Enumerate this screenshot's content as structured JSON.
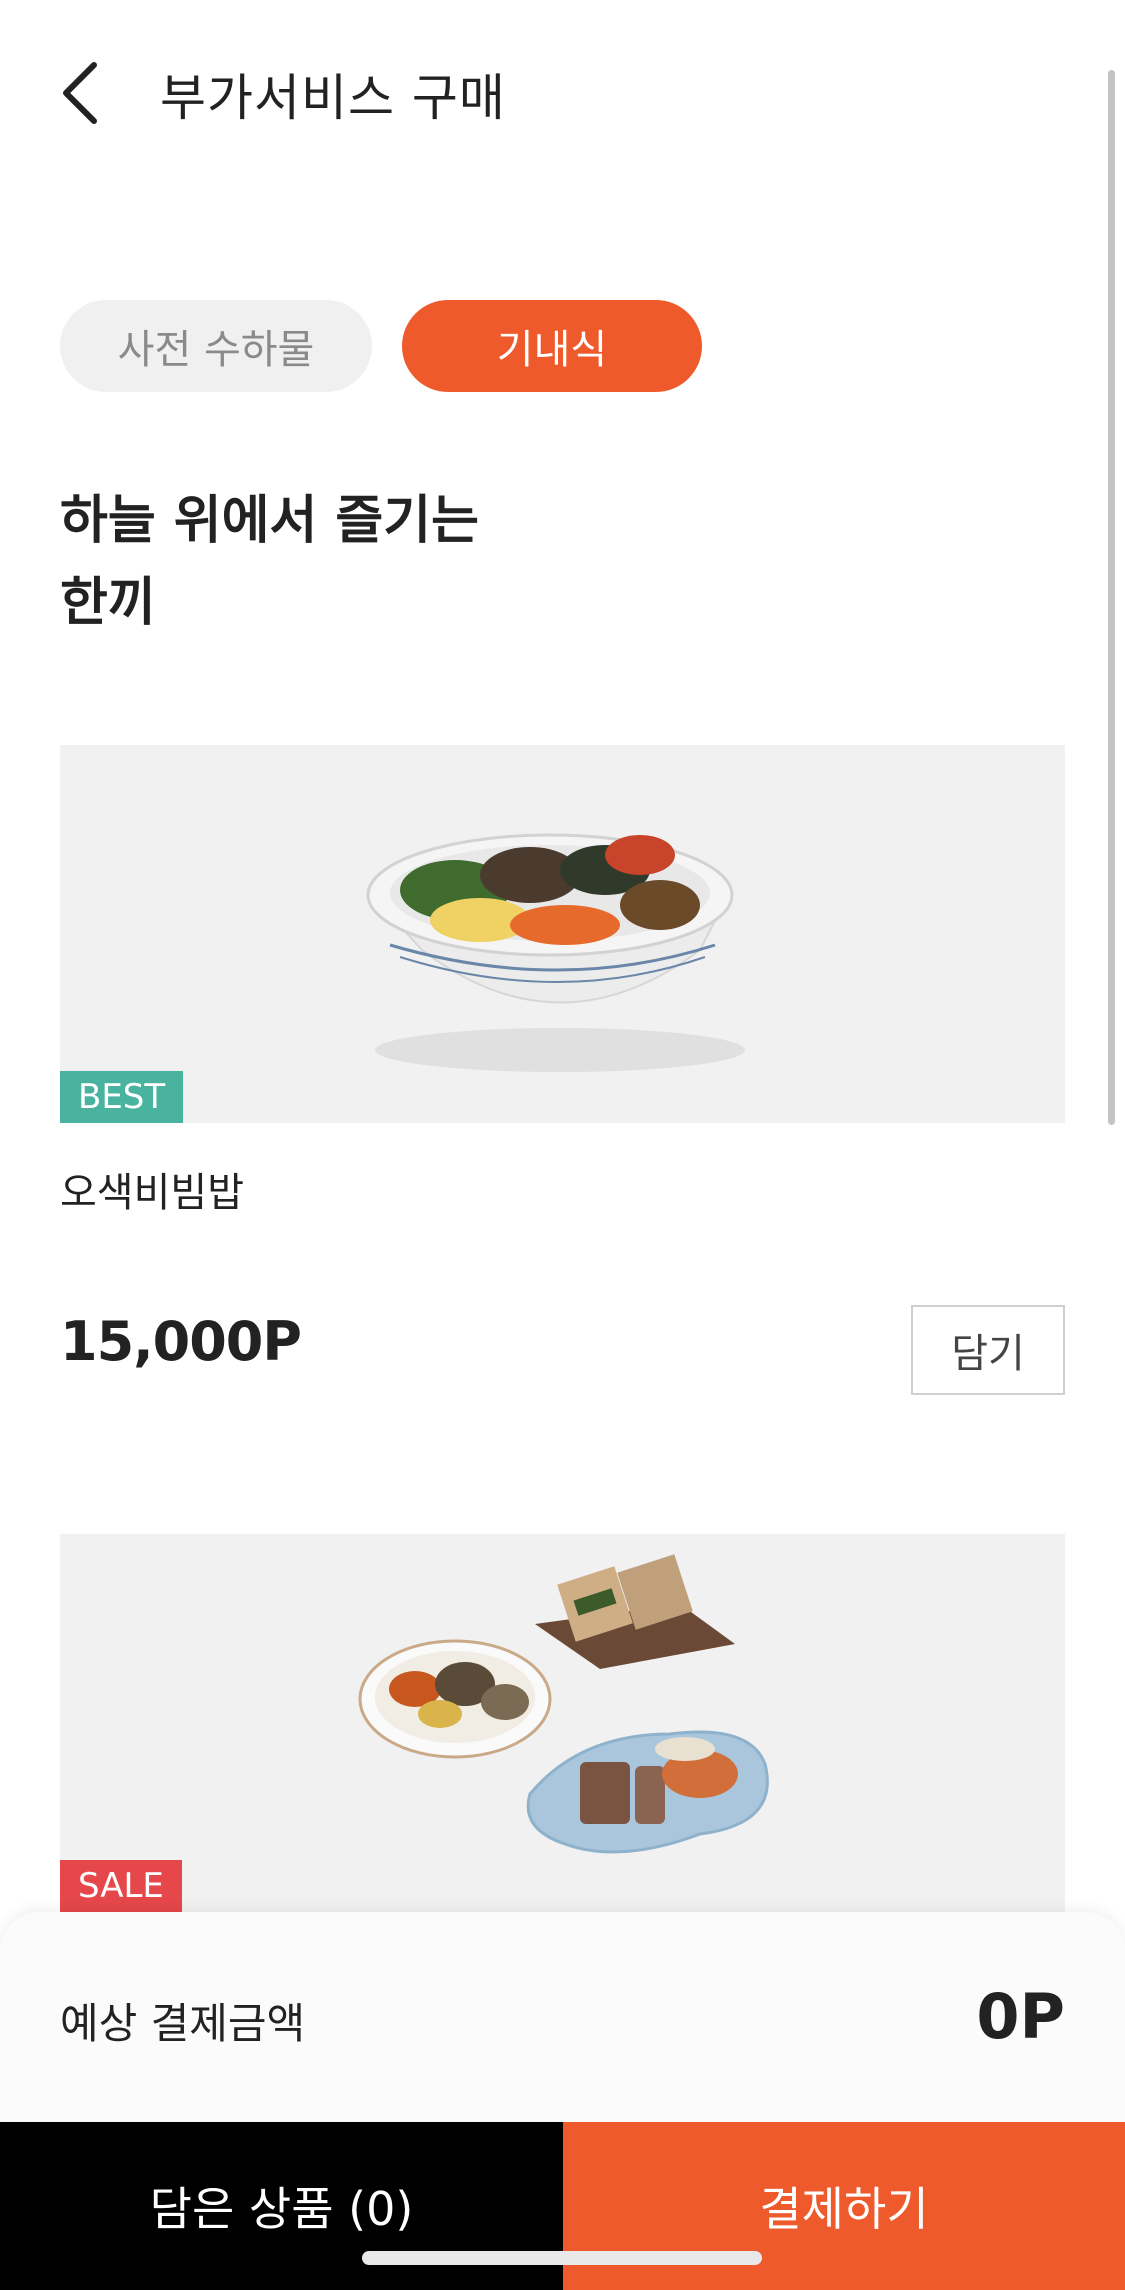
{
  "header": {
    "title": "부가서비스 구매",
    "back_icon": "chevron-left-icon"
  },
  "tabs": [
    {
      "label": "사전 수하물",
      "active": false
    },
    {
      "label": "기내식",
      "active": true
    }
  ],
  "headline": {
    "line1": "하늘 위에서 즐기는",
    "line2": "한끼"
  },
  "products": [
    {
      "badge": "BEST",
      "name": "오색비빔밥",
      "price": "15,000P",
      "add_label": "담기",
      "image": "bibimbap-bowl"
    },
    {
      "badge": "SALE",
      "image": "sandwich-and-side-dishes"
    }
  ],
  "summary": {
    "label": "예상 결제금액",
    "value": "0P"
  },
  "bottom_bar": {
    "cart_label": "담은 상품 (0)",
    "pay_label": "결제하기"
  },
  "colors": {
    "accent": "#ee5a2b",
    "best_badge": "#4ab3a0",
    "sale_badge": "#e6474a",
    "tab_inactive_bg": "#f0f0f0"
  }
}
